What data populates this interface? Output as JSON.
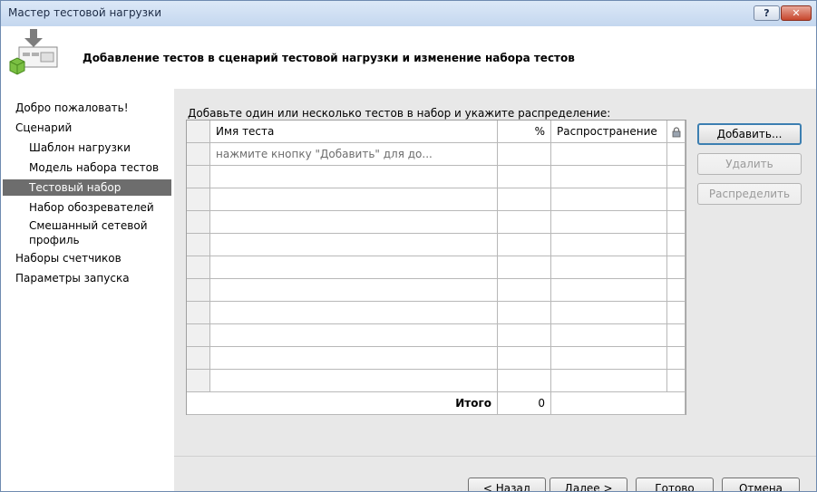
{
  "window": {
    "title": "Мастер тестовой нагрузки"
  },
  "titlebar": {
    "help_label": "?",
    "close_label": "✕"
  },
  "header": {
    "title": "Добавление тестов в сценарий тестовой нагрузки и изменение набора тестов"
  },
  "nav": {
    "items": [
      {
        "label": "Добро пожаловать!",
        "level": 1,
        "selected": false
      },
      {
        "label": "Сценарий",
        "level": 1,
        "selected": false
      },
      {
        "label": "Шаблон нагрузки",
        "level": 2,
        "selected": false
      },
      {
        "label": "Модель набора тестов",
        "level": 2,
        "selected": false
      },
      {
        "label": "Тестовый набор",
        "level": 2,
        "selected": true
      },
      {
        "label": "Набор обозревателей",
        "level": 2,
        "selected": false
      },
      {
        "label": "Смешанный сетевой профиль",
        "level": 2,
        "selected": false
      },
      {
        "label": "Наборы счетчиков",
        "level": 1,
        "selected": false
      },
      {
        "label": "Параметры запуска",
        "level": 1,
        "selected": false
      }
    ]
  },
  "main": {
    "instruction": "Добавьте один или несколько тестов в набор и укажите распределение:",
    "grid": {
      "columns": [
        "Имя теста",
        "%",
        "Распространение",
        "lock-icon"
      ],
      "placeholder_row": "нажмите кнопку \"Добавить\" для до...",
      "empty_rows": 10,
      "total_label": "Итого",
      "total_value": "0"
    },
    "buttons": {
      "add": "Добавить...",
      "remove": "Удалить",
      "distribute": "Распределить"
    }
  },
  "footer": {
    "back": "< Назад",
    "next": "Далее >",
    "finish": "Готово",
    "cancel": "Отмена"
  }
}
